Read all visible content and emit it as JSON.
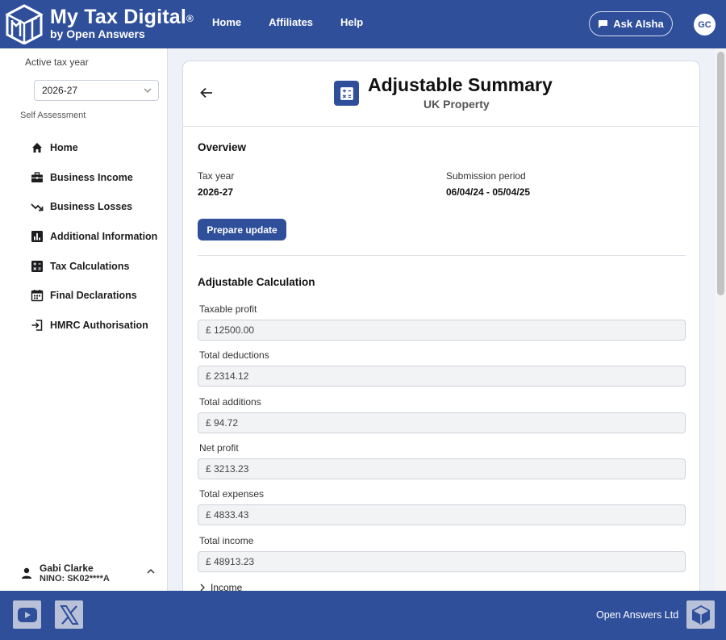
{
  "header": {
    "brand_title": "My Tax Digital",
    "brand_mark": "®",
    "brand_sub": "by Open Answers",
    "nav": [
      "Home",
      "Affiliates",
      "Help"
    ],
    "ask_label": "Ask AIsha",
    "avatar_initials": "GC",
    "accent": "#2f4f9b"
  },
  "sidebar": {
    "tax_year_label": "Active tax year",
    "tax_year_value": "2026-27",
    "section_label": "Self Assessment",
    "items": [
      {
        "label": "Home",
        "icon": "home-icon"
      },
      {
        "label": "Business Income",
        "icon": "briefcase-icon"
      },
      {
        "label": "Business Losses",
        "icon": "trending-down-icon"
      },
      {
        "label": "Additional Information",
        "icon": "bar-chart-icon"
      },
      {
        "label": "Tax Calculations",
        "icon": "calculator-icon"
      },
      {
        "label": "Final Declarations",
        "icon": "calendar-icon"
      },
      {
        "label": "HMRC Authorisation",
        "icon": "login-icon"
      }
    ],
    "user_name": "Gabi Clarke",
    "user_nino": "NINO: SK02****A"
  },
  "main": {
    "title": "Adjustable Summary",
    "subtitle": "UK Property",
    "overview_title": "Overview",
    "tax_year_label": "Tax year",
    "tax_year_value": "2026-27",
    "period_label": "Submission period",
    "period_value": "06/04/24 - 05/04/25",
    "prepare_button": "Prepare update",
    "calc_title": "Adjustable Calculation",
    "fields": [
      {
        "label": "Taxable profit",
        "value": "£ 12500.00"
      },
      {
        "label": "Total deductions",
        "value": "£ 2314.12"
      },
      {
        "label": "Total additions",
        "value": "£ 94.72"
      },
      {
        "label": "Net profit",
        "value": "£ 3213.23"
      },
      {
        "label": "Total expenses",
        "value": "£ 4833.43"
      },
      {
        "label": "Total income",
        "value": "£ 48913.23"
      }
    ],
    "income_toggle": "Income"
  },
  "footer": {
    "company": "Open Answers Ltd"
  }
}
